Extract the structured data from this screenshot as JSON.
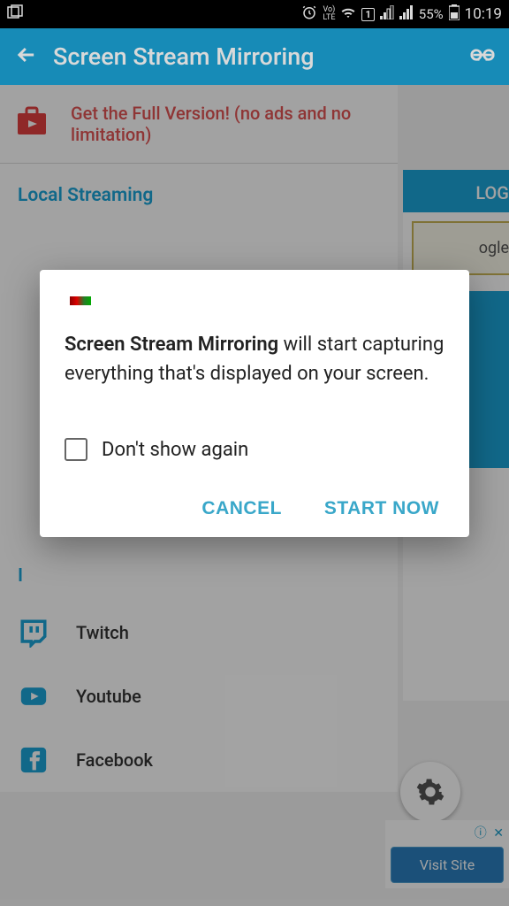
{
  "status": {
    "battery": "55%",
    "time": "10:19",
    "lte": "LTE",
    "volte": "Vo)"
  },
  "header": {
    "title": "Screen Stream Mirroring"
  },
  "promo": {
    "text": "Get the Full Version! (no ads and no limitation)"
  },
  "sections": {
    "local_streaming": "Local Streaming",
    "internet_prefix": "I"
  },
  "services": {
    "twitch": "Twitch",
    "youtube": "Youtube",
    "facebook": "Facebook"
  },
  "side": {
    "logs": "LOGS",
    "ogle": "ogle",
    "visit": "Visit Site"
  },
  "dialog": {
    "app_name": "Screen Stream Mirroring",
    "message_rest": " will start capturing everything that's displayed on your screen.",
    "checkbox": "Don't show again",
    "cancel": "CANCEL",
    "start": "START NOW"
  }
}
